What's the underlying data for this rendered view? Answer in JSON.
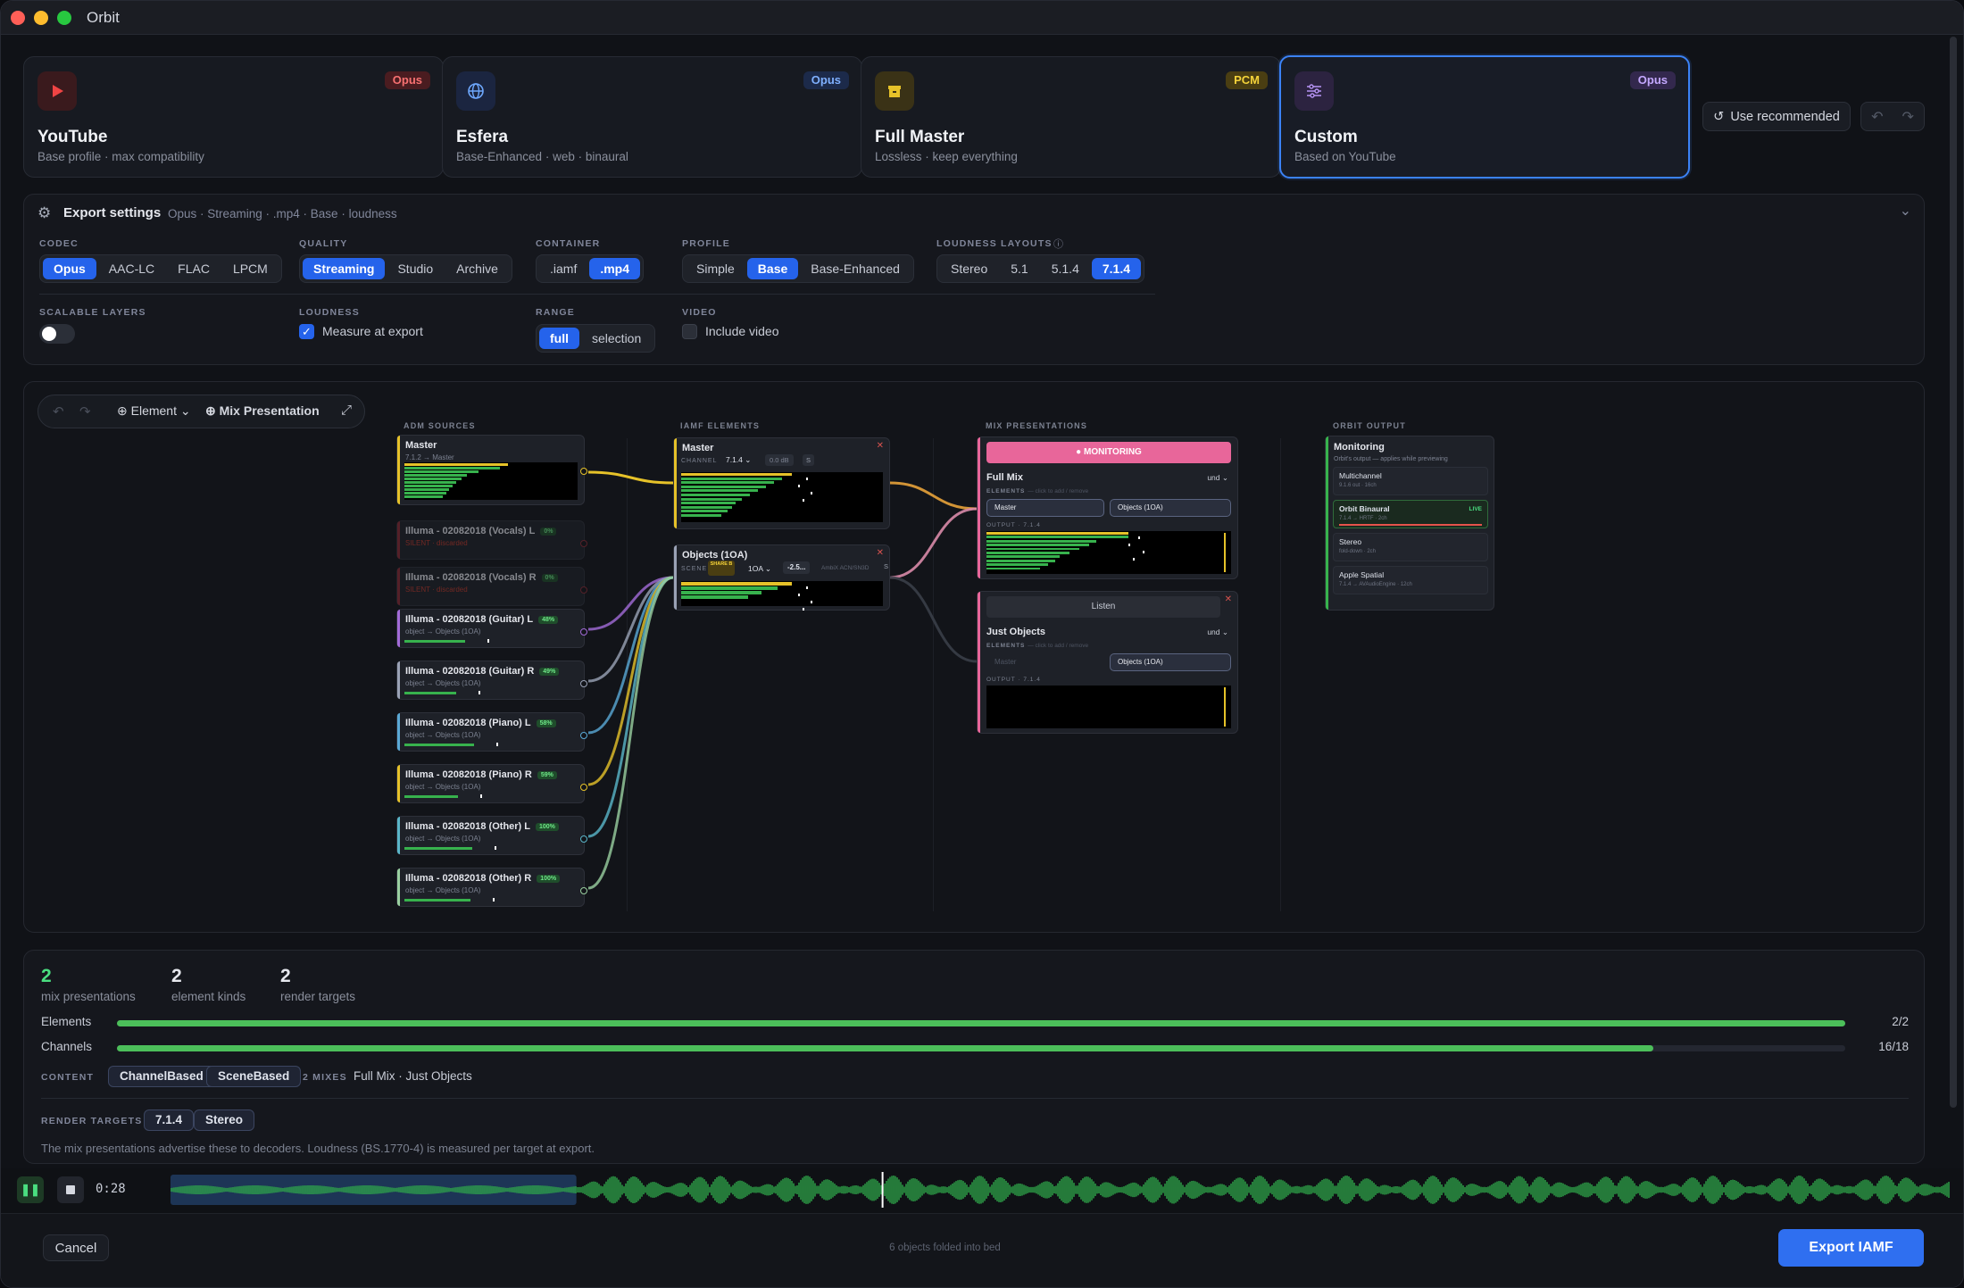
{
  "app": {
    "title": "Orbit"
  },
  "profiles": [
    {
      "title": "YouTube",
      "subtitle": "Base profile · max compatibility",
      "badge": "Opus",
      "icon": "play-icon"
    },
    {
      "title": "Esfera",
      "subtitle": "Base-Enhanced · web · binaural",
      "badge": "Opus",
      "icon": "globe-icon"
    },
    {
      "title": "Full Master",
      "subtitle": "Lossless · keep everything",
      "badge": "PCM",
      "icon": "archive-icon"
    },
    {
      "title": "Custom",
      "subtitle": "Based on YouTube",
      "badge": "Opus",
      "icon": "sliders-icon"
    }
  ],
  "toolbar": {
    "use_recommended": "Use recommended"
  },
  "export_settings": {
    "title": "Export settings",
    "summary": "Opus · Streaming · .mp4 · Base · loudness",
    "codec": {
      "label": "CODEC",
      "options": [
        "Opus",
        "AAC-LC",
        "FLAC",
        "LPCM"
      ],
      "selected": "Opus"
    },
    "quality": {
      "label": "QUALITY",
      "options": [
        "Streaming",
        "Studio",
        "Archive"
      ],
      "selected": "Streaming"
    },
    "container": {
      "label": "CONTAINER",
      "options": [
        ".iamf",
        ".mp4"
      ],
      "selected": ".mp4"
    },
    "profile": {
      "label": "PROFILE",
      "options": [
        "Simple",
        "Base",
        "Base-Enhanced"
      ],
      "selected": "Base"
    },
    "loudness_layouts": {
      "label": "LOUDNESS LAYOUTS",
      "options": [
        "Stereo",
        "5.1",
        "5.1.4",
        "7.1.4"
      ],
      "selected": "7.1.4"
    },
    "scalable_layers": {
      "label": "SCALABLE LAYERS",
      "on": false
    },
    "loudness": {
      "label": "LOUDNESS",
      "checkbox": "Measure at export",
      "checked": true
    },
    "range": {
      "label": "RANGE",
      "options": [
        "full",
        "selection"
      ],
      "selected": "full"
    },
    "video": {
      "label": "VIDEO",
      "checkbox": "Include video",
      "checked": false
    }
  },
  "graph_toolbar": {
    "element": "Element",
    "mix_presentation": "Mix Presentation"
  },
  "graph": {
    "adm_header": "ADM SOURCES",
    "iamf_header": "IAMF ELEMENTS",
    "mix_header": "MIX PRESENTATIONS",
    "output_header": "ORBIT OUTPUT",
    "sources": [
      {
        "name": "Master",
        "sub": "7.1.2 → Master",
        "pct": "",
        "color": "#e6c229"
      },
      {
        "name": "Illuma - 02082018 (Vocals) L",
        "sub": "SILENT · discarded",
        "pct": "0%",
        "color": "#8a2b35"
      },
      {
        "name": "Illuma - 02082018 (Vocals) R",
        "sub": "SILENT · discarded",
        "pct": "0%",
        "color": "#8a2b35"
      },
      {
        "name": "Illuma - 02082018 (Guitar) L",
        "sub": "object → Objects (1OA)",
        "pct": "48%",
        "color": "#a36bd8"
      },
      {
        "name": "Illuma - 02082018 (Guitar) R",
        "sub": "object → Objects (1OA)",
        "pct": "49%",
        "color": "#9aa2b5"
      },
      {
        "name": "Illuma - 02082018 (Piano) L",
        "sub": "object → Objects (1OA)",
        "pct": "58%",
        "color": "#5aa9d6"
      },
      {
        "name": "Illuma - 02082018 (Piano) R",
        "sub": "object → Objects (1OA)",
        "pct": "59%",
        "color": "#e6c229"
      },
      {
        "name": "Illuma - 02082018 (Other) L",
        "sub": "object → Objects (1OA)",
        "pct": "100%",
        "color": "#5ab6c9"
      },
      {
        "name": "Illuma - 02082018 (Other) R",
        "sub": "object → Objects (1OA)",
        "pct": "100%",
        "color": "#9ad0a0"
      }
    ],
    "elements": [
      {
        "name": "Master",
        "field_label": "CHANNEL",
        "layout": "7.1.4",
        "gain": "0.0 dB",
        "s": "S"
      },
      {
        "name": "Objects (1OA)",
        "field_label": "SCENE",
        "share": "SHARE B",
        "layout": "1OA",
        "gain": "-2.5...",
        "extra": "AmbiX ACN/SN3D",
        "s": "S"
      }
    ],
    "mixes": [
      {
        "banner": "MONITORING",
        "name": "Full Mix",
        "lang": "und",
        "elements_label": "ELEMENTS",
        "elements_hint": "— click to add / remove",
        "pills": [
          "Master",
          "Objects (1OA)"
        ],
        "output_label": "OUTPUT · 7.1.4"
      },
      {
        "banner": "Listen",
        "name": "Just Objects",
        "lang": "und",
        "elements_label": "ELEMENTS",
        "elements_hint": "— click to add / remove",
        "pills": [
          "Master",
          "Objects (1OA)"
        ],
        "output_label": "OUTPUT · 7.1.4"
      }
    ],
    "output": {
      "title": "Monitoring",
      "subtitle": "Orbit's output — applies while previewing",
      "items": [
        {
          "name": "Multichannel",
          "sub": "9.1.6 out · 16ch",
          "live": ""
        },
        {
          "name": "Orbit Binaural",
          "sub": "7.1.4 → HRTF · 2ch",
          "live": "LIVE"
        },
        {
          "name": "Stereo",
          "sub": "fold-down · 2ch",
          "live": ""
        },
        {
          "name": "Apple Spatial",
          "sub": "7.1.4 → AVAudioEngine · 12ch",
          "live": ""
        }
      ]
    }
  },
  "summary": {
    "stats": [
      {
        "value": "2",
        "label": "mix presentations"
      },
      {
        "value": "2",
        "label": "element kinds"
      },
      {
        "value": "2",
        "label": "render targets"
      }
    ],
    "elements": {
      "label": "Elements",
      "value": "2/2",
      "fraction": 1.0
    },
    "channels": {
      "label": "Channels",
      "value": "16/18",
      "fraction": 0.889
    },
    "content_label": "CONTENT",
    "content_tags": [
      "ChannelBased",
      "SceneBased"
    ],
    "mixes_label": "2 MIXES",
    "mixes_text": "Full Mix · Just Objects",
    "render_label": "RENDER TARGETS",
    "render_tags": [
      "7.1.4",
      "Stereo"
    ],
    "note": "The mix presentations advertise these to decoders. Loudness (BS.1770-4) is measured per target at export."
  },
  "transport": {
    "time": "0:28",
    "playhead_fraction": 0.4,
    "selection_fraction": 0.228
  },
  "footer": {
    "cancel": "Cancel",
    "status": "6 objects folded into bed",
    "export": "Export IAMF"
  },
  "colors": {
    "accent": "#3b82f6",
    "meter_green": "#37b24d",
    "meter_yellow": "#e6c229",
    "monitor_pink": "#e8669a"
  }
}
